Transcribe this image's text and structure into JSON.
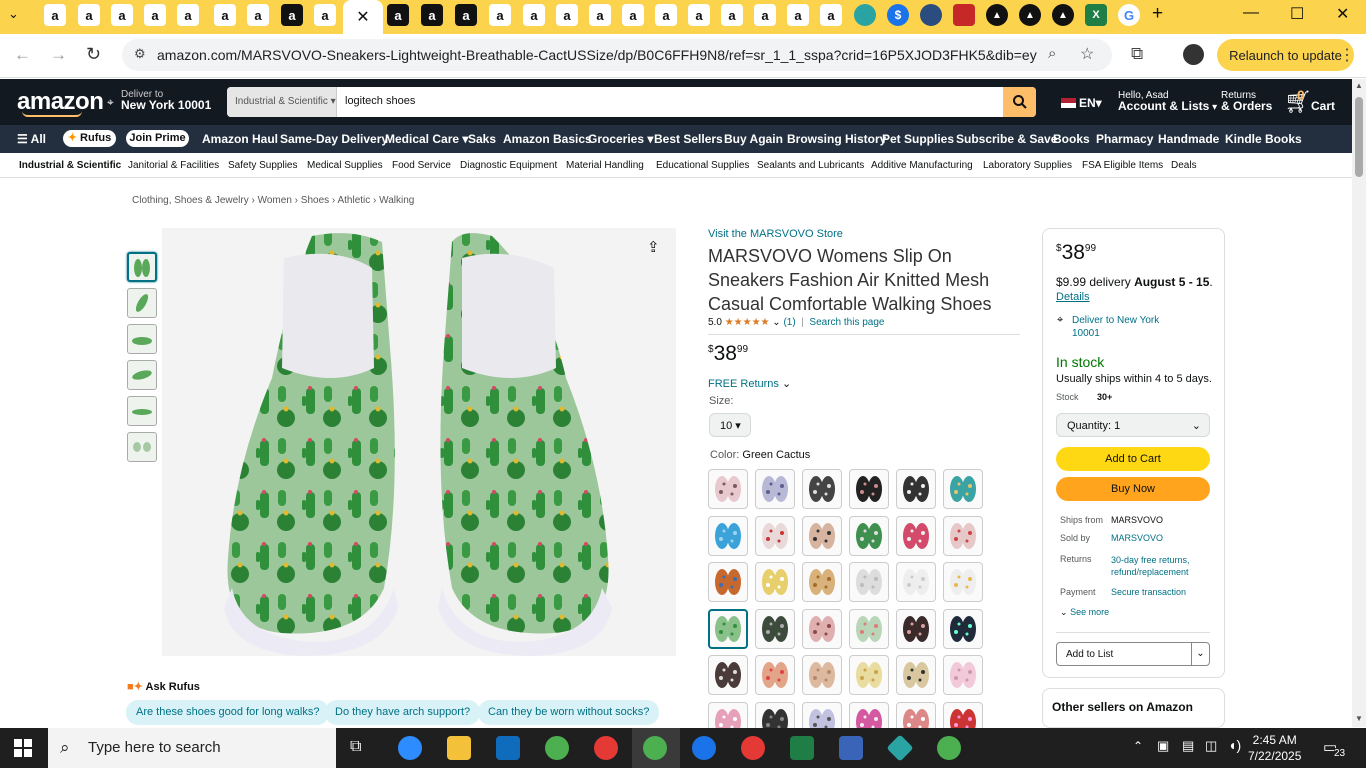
{
  "browser": {
    "tabs_amazon_glyph": "a",
    "url": "amazon.com/MARSVOVO-Sneakers-Lightweight-Breathable-CactUSSize/dp/B0C6FFH9N8/ref=sr_1_1_sspa?crid=16P5XJOD3FHK5&dib=eyJ2I...",
    "relaunch_label": "Relaunch to update"
  },
  "header": {
    "logo": "amazon",
    "deliver_line1": "Deliver to",
    "deliver_line2": "New York 10001",
    "search_category": "Industrial & Scientific",
    "search_value": "logitech shoes",
    "language": "EN",
    "account_line1": "Hello, Asad",
    "account_line2": "Account & Lists",
    "returns_line1": "Returns",
    "returns_line2": "& Orders",
    "cart_count": "0",
    "cart_label": "Cart"
  },
  "nav": {
    "all": "All",
    "rufus": "Rufus",
    "join_prime": "Join Prime",
    "items": [
      "Amazon Haul",
      "Same-Day Delivery",
      "Medical Care",
      "Saks",
      "Amazon Basics",
      "Groceries",
      "Best Sellers",
      "Buy Again",
      "Browsing History",
      "Pet Supplies",
      "Subscribe & Save",
      "Books",
      "Pharmacy",
      "Handmade",
      "Kindle Books"
    ]
  },
  "subnav": {
    "items": [
      "Industrial & Scientific",
      "Janitorial & Facilities",
      "Safety Supplies",
      "Medical Supplies",
      "Food Service",
      "Diagnostic Equipment",
      "Material Handling",
      "Educational Supplies",
      "Sealants and Lubricants",
      "Additive Manufacturing",
      "Laboratory Supplies",
      "FSA Eligible Items",
      "Deals"
    ]
  },
  "breadcrumb": "Clothing, Shoes & Jewelry › Women › Shoes › Athletic › Walking",
  "product": {
    "store_link": "Visit the MARSVOVO Store",
    "title": "MARSVOVO Womens Slip On Sneakers Fashion Air Knitted Mesh Casual Comfortable Walking Shoes",
    "rating_value": "5.0",
    "stars": "★★★★★",
    "review_count": "(1)",
    "search_page": "Search this page",
    "price_symbol": "$",
    "price_whole": "38",
    "price_fraction": "99",
    "free_returns": "FREE Returns",
    "size_label": "Size:",
    "size_value": "10",
    "color_label": "Color:",
    "color_value": "Green Cactus"
  },
  "buybox": {
    "price_symbol": "$",
    "price_whole": "38",
    "price_fraction": "99",
    "delivery_prefix": "$9.99 delivery",
    "delivery_dates": "August 5 - 15",
    "delivery_suffix": ".",
    "details": "Details",
    "deliver_to_line1": "Deliver to New York",
    "deliver_to_line2": "10001",
    "in_stock": "In stock",
    "ships": "Usually ships within 4 to 5 days.",
    "stock_label": "Stock",
    "stock_value": "30+",
    "quantity": "Quantity:  1",
    "add_to_cart": "Add to Cart",
    "buy_now": "Buy Now",
    "ships_from_label": "Ships from",
    "ships_from_value": "MARSVOVO",
    "sold_by_label": "Sold by",
    "sold_by_value": "MARSVOVO",
    "returns_label": "Returns",
    "returns_value_1": "30-day free returns,",
    "returns_value_2": "refund/replacement",
    "payment_label": "Payment",
    "payment_value": "Secure transaction",
    "see_more": "See more",
    "add_to_list": "Add to List"
  },
  "other_sellers": "Other sellers on Amazon",
  "rufus": {
    "title": "Ask Rufus",
    "questions": [
      "Are these shoes good for long walks?",
      "Do they have arch support?",
      "Can they be worn without socks?"
    ]
  },
  "taskbar": {
    "search_placeholder": "Type here to search",
    "time": "2:45 AM",
    "date": "7/22/2025",
    "notification_count": "23"
  },
  "colors": {
    "amazon_dark": "#131921",
    "amazon_nav": "#232f3e",
    "amazon_orange": "#febd69",
    "add_to_cart": "#ffd814",
    "buy_now": "#ffa41c",
    "link": "#007185",
    "in_stock": "#007600",
    "tab_strip": "#fcd34d"
  }
}
